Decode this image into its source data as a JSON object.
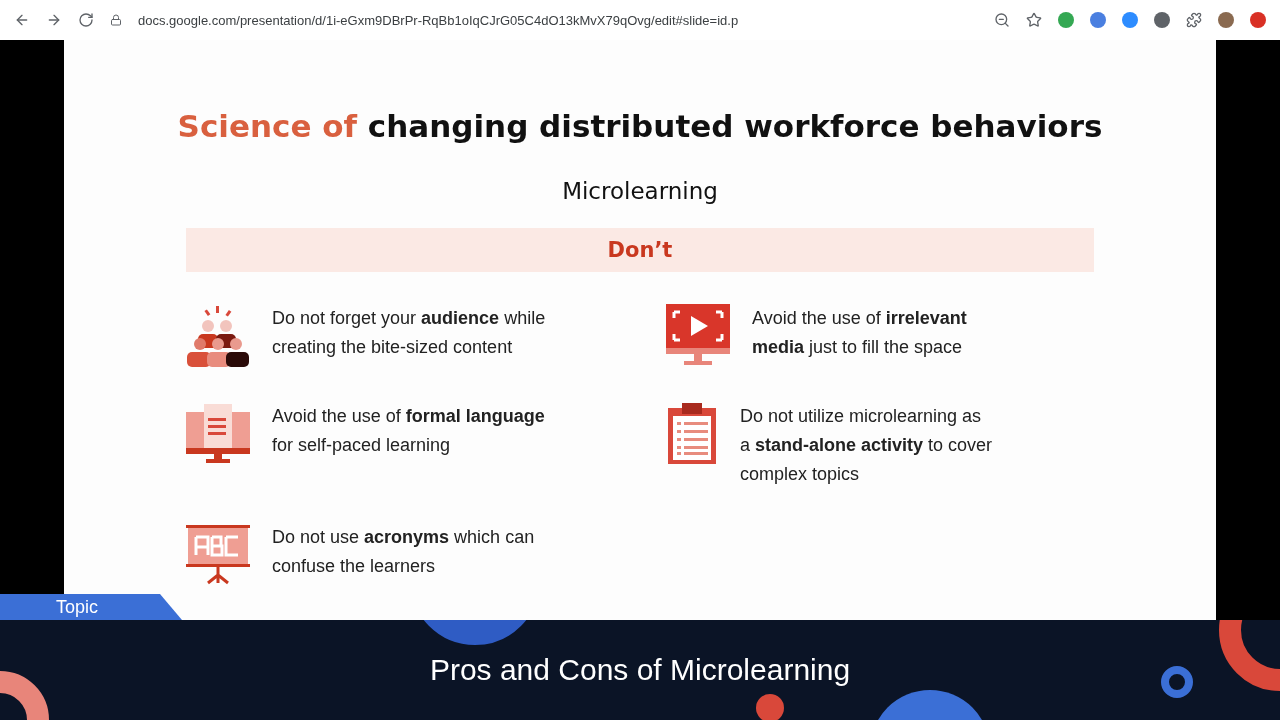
{
  "browser": {
    "url": "docs.google.com/presentation/d/1i-eGxm9DBrPr-RqBb1oIqCJrG05C4dO13kMvX79qOvg/edit#slide=id.p"
  },
  "slide": {
    "title_accent": "Science of",
    "title_rest": "changing distributed workforce behaviors",
    "subtitle": "Microlearning",
    "banner": "Don’t",
    "items": [
      {
        "kind": "audience",
        "text": "Do not forget your **audience** while\ncreating the bite-sized content"
      },
      {
        "kind": "video",
        "text": "Avoid the use of **irrelevant**\n**media** just to fill the space"
      },
      {
        "kind": "document",
        "text": "Avoid the use of **formal language**\nfor self-paced learning"
      },
      {
        "kind": "clipboard",
        "text": "Do not utilize microlearning as\na **stand-alone activity** to cover\ncomplex topics"
      },
      {
        "kind": "board",
        "text": "Do not use **acronyms** which can\nconfuse the learners"
      }
    ]
  },
  "lower_third": {
    "tag": "Topic",
    "title": "Pros and Cons of Microlearning"
  }
}
